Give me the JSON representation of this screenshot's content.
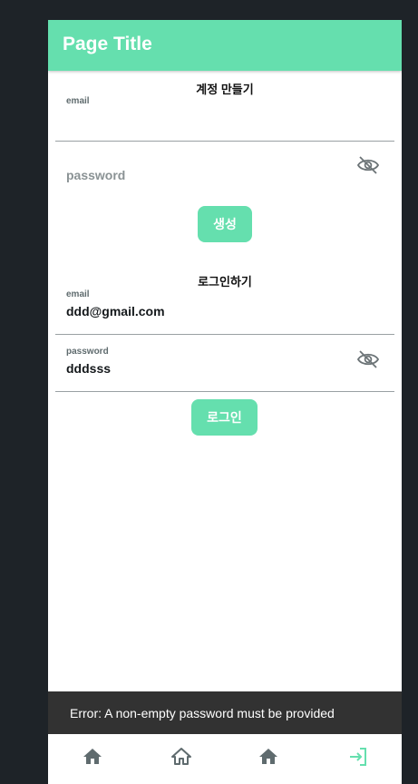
{
  "appbar": {
    "title": "Page Title"
  },
  "signup": {
    "section_title": "계정 만들기",
    "email_label": "email",
    "email_value": "",
    "password_placeholder": "password",
    "password_value": "",
    "submit_label": "생성"
  },
  "login": {
    "section_title": "로그인하기",
    "email_label": "email",
    "email_value": "ddd@gmail.com",
    "password_label": "password",
    "password_value": "dddsss",
    "submit_label": "로그인"
  },
  "snackbar": {
    "message": "Error: A non-empty password must be provided"
  },
  "bottom_nav": {
    "items": [
      {
        "icon": "home-icon"
      },
      {
        "icon": "home-outline-icon"
      },
      {
        "icon": "home-icon"
      },
      {
        "icon": "login-icon",
        "active": true
      }
    ]
  },
  "colors": {
    "accent": "#65dfae",
    "background": "#1e2328",
    "snackbar": "#323232",
    "nav_inactive": "#5f6b6e"
  }
}
